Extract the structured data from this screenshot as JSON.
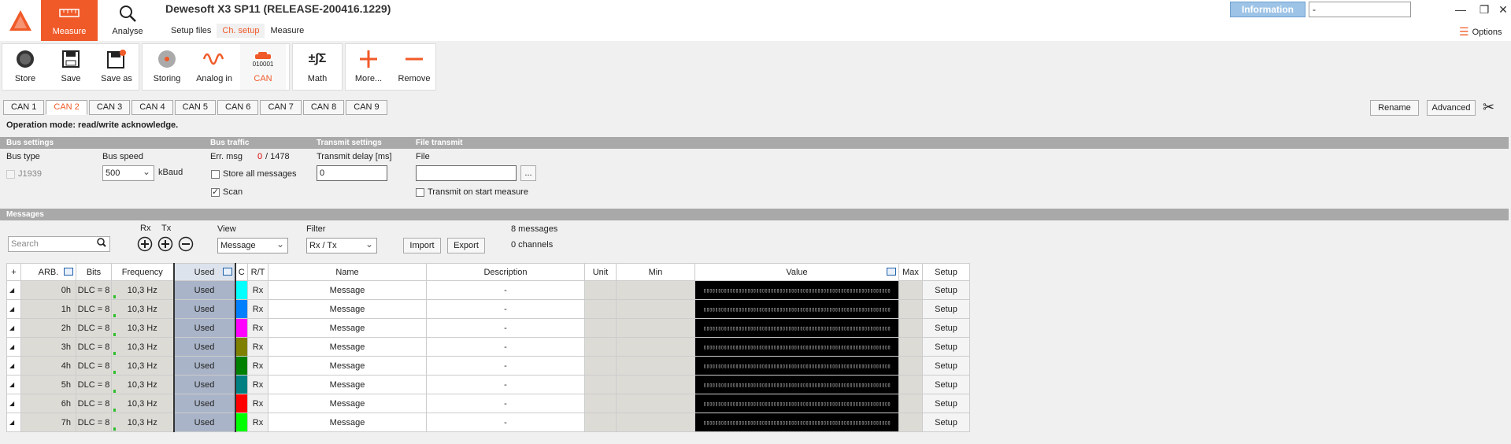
{
  "app": {
    "title": "Dewesoft X3 SP11 (RELEASE-200416.1229)",
    "information_label": "Information",
    "info_field_value": "-",
    "options_label": "Options"
  },
  "topnav": [
    {
      "label": "Measure",
      "icon": "ruler-icon",
      "active": true
    },
    {
      "label": "Analyse",
      "icon": "magnifier-icon",
      "active": false
    }
  ],
  "subtabs": [
    {
      "label": "Setup files",
      "active": false
    },
    {
      "label": "Ch. setup",
      "active": true
    },
    {
      "label": "Measure",
      "active": false
    }
  ],
  "ribbon": {
    "store": "Store",
    "save": "Save",
    "save_as": "Save as",
    "storing": "Storing",
    "analog_in": "Analog in",
    "can": "CAN",
    "can_icon_text": "010001",
    "math": "Math",
    "more": "More...",
    "remove": "Remove"
  },
  "can_tabs": [
    "CAN 1",
    "CAN 2",
    "CAN 3",
    "CAN 4",
    "CAN 5",
    "CAN 6",
    "CAN 7",
    "CAN 8",
    "CAN 9"
  ],
  "active_can_tab": 1,
  "rename_label": "Rename",
  "advanced_label": "Advanced",
  "operation_mode": "Operation mode: read/write acknowledge.",
  "bus_settings": {
    "header": "Bus settings",
    "bus_type_label": "Bus type",
    "j1939_label": "J1939",
    "bus_speed_label": "Bus speed",
    "bus_speed_value": "500",
    "bus_speed_unit": "kBaud"
  },
  "bus_traffic": {
    "header": "Bus traffic",
    "err_msg_label": "Err. msg",
    "err_msg_count": "0",
    "err_msg_total": "/ 1478",
    "store_all_label": "Store all messages",
    "scan_label": "Scan"
  },
  "transmit_settings": {
    "header": "Transmit settings",
    "delay_label": "Transmit delay [ms]",
    "delay_value": "0"
  },
  "file_transmit": {
    "header": "File transmit",
    "file_label": "File",
    "file_value": "",
    "browse_label": "...",
    "on_start_label": "Transmit on start measure"
  },
  "messages": {
    "header": "Messages",
    "search_placeholder": "Search",
    "rx_label": "Rx",
    "tx_label": "Tx",
    "view_label": "View",
    "view_value": "Message",
    "filter_label": "Filter",
    "filter_value": "Rx / Tx",
    "import_label": "Import",
    "export_label": "Export",
    "messages_count": "8 messages",
    "channels_count": "0 channels"
  },
  "table": {
    "columns": [
      "+",
      "ARB.",
      "Bits",
      "Frequency",
      "Used",
      "C",
      "R/T",
      "Name",
      "Description",
      "Unit",
      "Min",
      "Value",
      "Max",
      "Setup"
    ],
    "rows": [
      {
        "arb": "0h",
        "bits": "DLC = 8",
        "freq": "10,3 Hz",
        "used": "Used",
        "color": "#00ffff",
        "rt": "Rx",
        "name": "Message",
        "desc": "-",
        "setup": "Setup"
      },
      {
        "arb": "1h",
        "bits": "DLC = 8",
        "freq": "10,3 Hz",
        "used": "Used",
        "color": "#0080ff",
        "rt": "Rx",
        "name": "Message",
        "desc": "-",
        "setup": "Setup"
      },
      {
        "arb": "2h",
        "bits": "DLC = 8",
        "freq": "10,3 Hz",
        "used": "Used",
        "color": "#ff00ff",
        "rt": "Rx",
        "name": "Message",
        "desc": "-",
        "setup": "Setup"
      },
      {
        "arb": "3h",
        "bits": "DLC = 8",
        "freq": "10,3 Hz",
        "used": "Used",
        "color": "#808000",
        "rt": "Rx",
        "name": "Message",
        "desc": "-",
        "setup": "Setup"
      },
      {
        "arb": "4h",
        "bits": "DLC = 8",
        "freq": "10,3 Hz",
        "used": "Used",
        "color": "#008000",
        "rt": "Rx",
        "name": "Message",
        "desc": "-",
        "setup": "Setup"
      },
      {
        "arb": "5h",
        "bits": "DLC = 8",
        "freq": "10,3 Hz",
        "used": "Used",
        "color": "#008080",
        "rt": "Rx",
        "name": "Message",
        "desc": "-",
        "setup": "Setup"
      },
      {
        "arb": "6h",
        "bits": "DLC = 8",
        "freq": "10,3 Hz",
        "used": "Used",
        "color": "#ff0000",
        "rt": "Rx",
        "name": "Message",
        "desc": "-",
        "setup": "Setup"
      },
      {
        "arb": "7h",
        "bits": "DLC = 8",
        "freq": "10,3 Hz",
        "used": "Used",
        "color": "#00ff00",
        "rt": "Rx",
        "name": "Message",
        "desc": "-",
        "setup": "Setup"
      }
    ]
  },
  "colors": {
    "accent": "#f05a28",
    "info_button": "#9dc3e6",
    "section_bar": "#a9a9a9"
  }
}
